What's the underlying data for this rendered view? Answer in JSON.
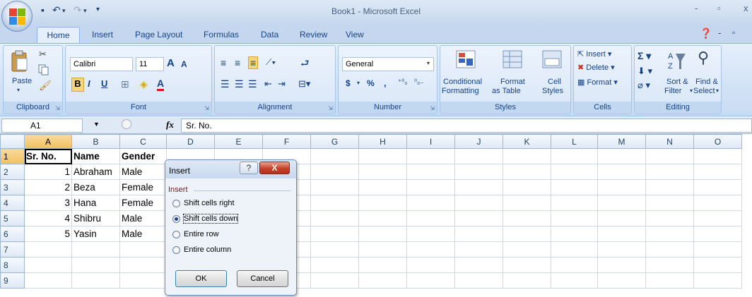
{
  "window": {
    "title": "Book1 - Microsoft Excel",
    "min": "-",
    "max": "▫",
    "close": "x"
  },
  "tabs": [
    "Home",
    "Insert",
    "Page Layout",
    "Formulas",
    "Data",
    "Review",
    "View"
  ],
  "ribbon": {
    "clipboard": {
      "label": "Clipboard",
      "paste": "Paste"
    },
    "font": {
      "label": "Font",
      "name": "Calibri",
      "size": "11",
      "grow": "A",
      "shrink": "A",
      "bold": "B",
      "italic": "I",
      "underline": "U"
    },
    "alignment": {
      "label": "Alignment"
    },
    "number": {
      "label": "Number",
      "format": "General",
      "currency": "$",
      "percent": "%",
      "comma": ","
    },
    "styles": {
      "label": "Styles",
      "cond1": "Conditional",
      "cond2": "Formatting",
      "table1": "Format",
      "table2": "as Table",
      "cell1": "Cell",
      "cell2": "Styles"
    },
    "cells": {
      "label": "Cells",
      "insert": "Insert",
      "delete": "Delete",
      "format": "Format"
    },
    "editing": {
      "label": "Editing",
      "sort1": "Sort &",
      "sort2": "Filter",
      "find1": "Find &",
      "find2": "Select"
    }
  },
  "formula_bar": {
    "namebox": "A1",
    "fx": "fx",
    "content": "Sr. No."
  },
  "sheet": {
    "columns": [
      "A",
      "B",
      "C",
      "D",
      "E",
      "F",
      "G",
      "H",
      "I",
      "J",
      "K",
      "L",
      "M",
      "N",
      "O"
    ],
    "rows": [
      {
        "n": "1",
        "a": "Sr. No.",
        "b": "Name",
        "c": "Gender"
      },
      {
        "n": "2",
        "a": "1",
        "b": "Abraham",
        "c": "Male"
      },
      {
        "n": "3",
        "a": "2",
        "b": "Beza",
        "c": "Female"
      },
      {
        "n": "4",
        "a": "3",
        "b": "Hana",
        "c": "Female"
      },
      {
        "n": "5",
        "a": "4",
        "b": "Shibru",
        "c": "Male"
      },
      {
        "n": "6",
        "a": "5",
        "b": "Yasin",
        "c": "Male"
      },
      {
        "n": "7",
        "a": "",
        "b": "",
        "c": ""
      },
      {
        "n": "8",
        "a": "",
        "b": "",
        "c": ""
      },
      {
        "n": "9",
        "a": "",
        "b": "",
        "c": ""
      }
    ]
  },
  "dialog": {
    "title": "Insert",
    "help": "?",
    "close": "X",
    "group": "Insert",
    "options": [
      "Shift cells right",
      "Shift cells down",
      "Entire row",
      "Entire column"
    ],
    "selected_option": "Shift cells down",
    "ok": "OK",
    "cancel": "Cancel"
  }
}
